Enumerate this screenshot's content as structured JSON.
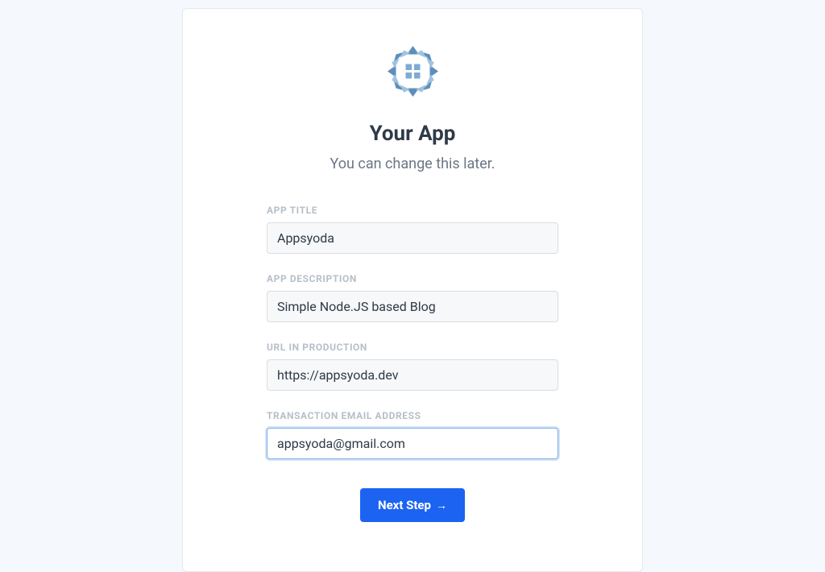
{
  "header": {
    "title": "Your App",
    "subtitle": "You can change this later."
  },
  "form": {
    "app_title": {
      "label": "App Title",
      "value": "Appsyoda"
    },
    "app_description": {
      "label": "App Description",
      "value": "Simple Node.JS based Blog"
    },
    "url_production": {
      "label": "URL in Production",
      "value": "https://appsyoda.dev"
    },
    "transaction_email": {
      "label": "Transaction Email Address",
      "value": "appsyoda@gmail.com"
    }
  },
  "actions": {
    "next_label": "Next Step",
    "next_arrow": "→"
  },
  "icon": "app-logo-icon",
  "colors": {
    "primary": "#1c63f2",
    "text": "#2f3a48",
    "muted": "#b5bfc9"
  }
}
